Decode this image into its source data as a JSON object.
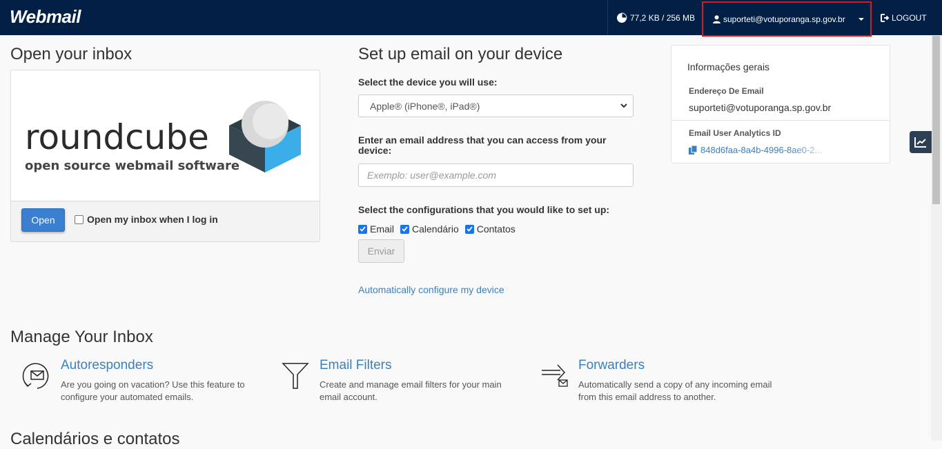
{
  "header": {
    "logo": "Webmail",
    "quota": "77,2 KB / 256 MB",
    "user": "suporteti@votuporanga.sp.gov.br",
    "logout": "LOGOUT"
  },
  "open_inbox": {
    "heading": "Open your inbox",
    "logo_word": "roundcube",
    "logo_tagline": "open source webmail software",
    "open_button": "Open",
    "checkbox_label": "Open my inbox when I log in"
  },
  "setup": {
    "heading": "Set up email on your device",
    "device_label": "Select the device you will use:",
    "device_selected": "Apple® (iPhone®, iPad®)",
    "email_label": "Enter an email address that you can access from your device:",
    "email_placeholder": "Exemplo: user@example.com",
    "config_label": "Select the configurations that you would like to set up:",
    "configs": [
      "Email",
      "Calendário",
      "Contatos"
    ],
    "submit": "Enviar",
    "auto_link": "Automatically configure my device"
  },
  "info": {
    "title": "Informações gerais",
    "email_label": "Endereço De Email",
    "email_value": "suporteti@votuporanga.sp.gov.br",
    "uid_label": "Email User Analytics ID",
    "uid_value": "848d6faa-8a4b-4996-8ae0-2..."
  },
  "manage": {
    "heading": "Manage Your Inbox",
    "features": [
      {
        "title": "Autoresponders",
        "desc": "Are you going on vacation? Use this feature to configure your automated emails."
      },
      {
        "title": "Email Filters",
        "desc": "Create and manage email filters for your main email account."
      },
      {
        "title": "Forwarders",
        "desc": "Automatically send a copy of any incoming email from this email address to another."
      }
    ]
  },
  "calendars": {
    "heading": "Calendários e contatos"
  },
  "colors": {
    "topbar": "#021f45",
    "link": "#3a7fbf",
    "primary_button": "#3a7fd0",
    "highlight": "#e0161b"
  }
}
